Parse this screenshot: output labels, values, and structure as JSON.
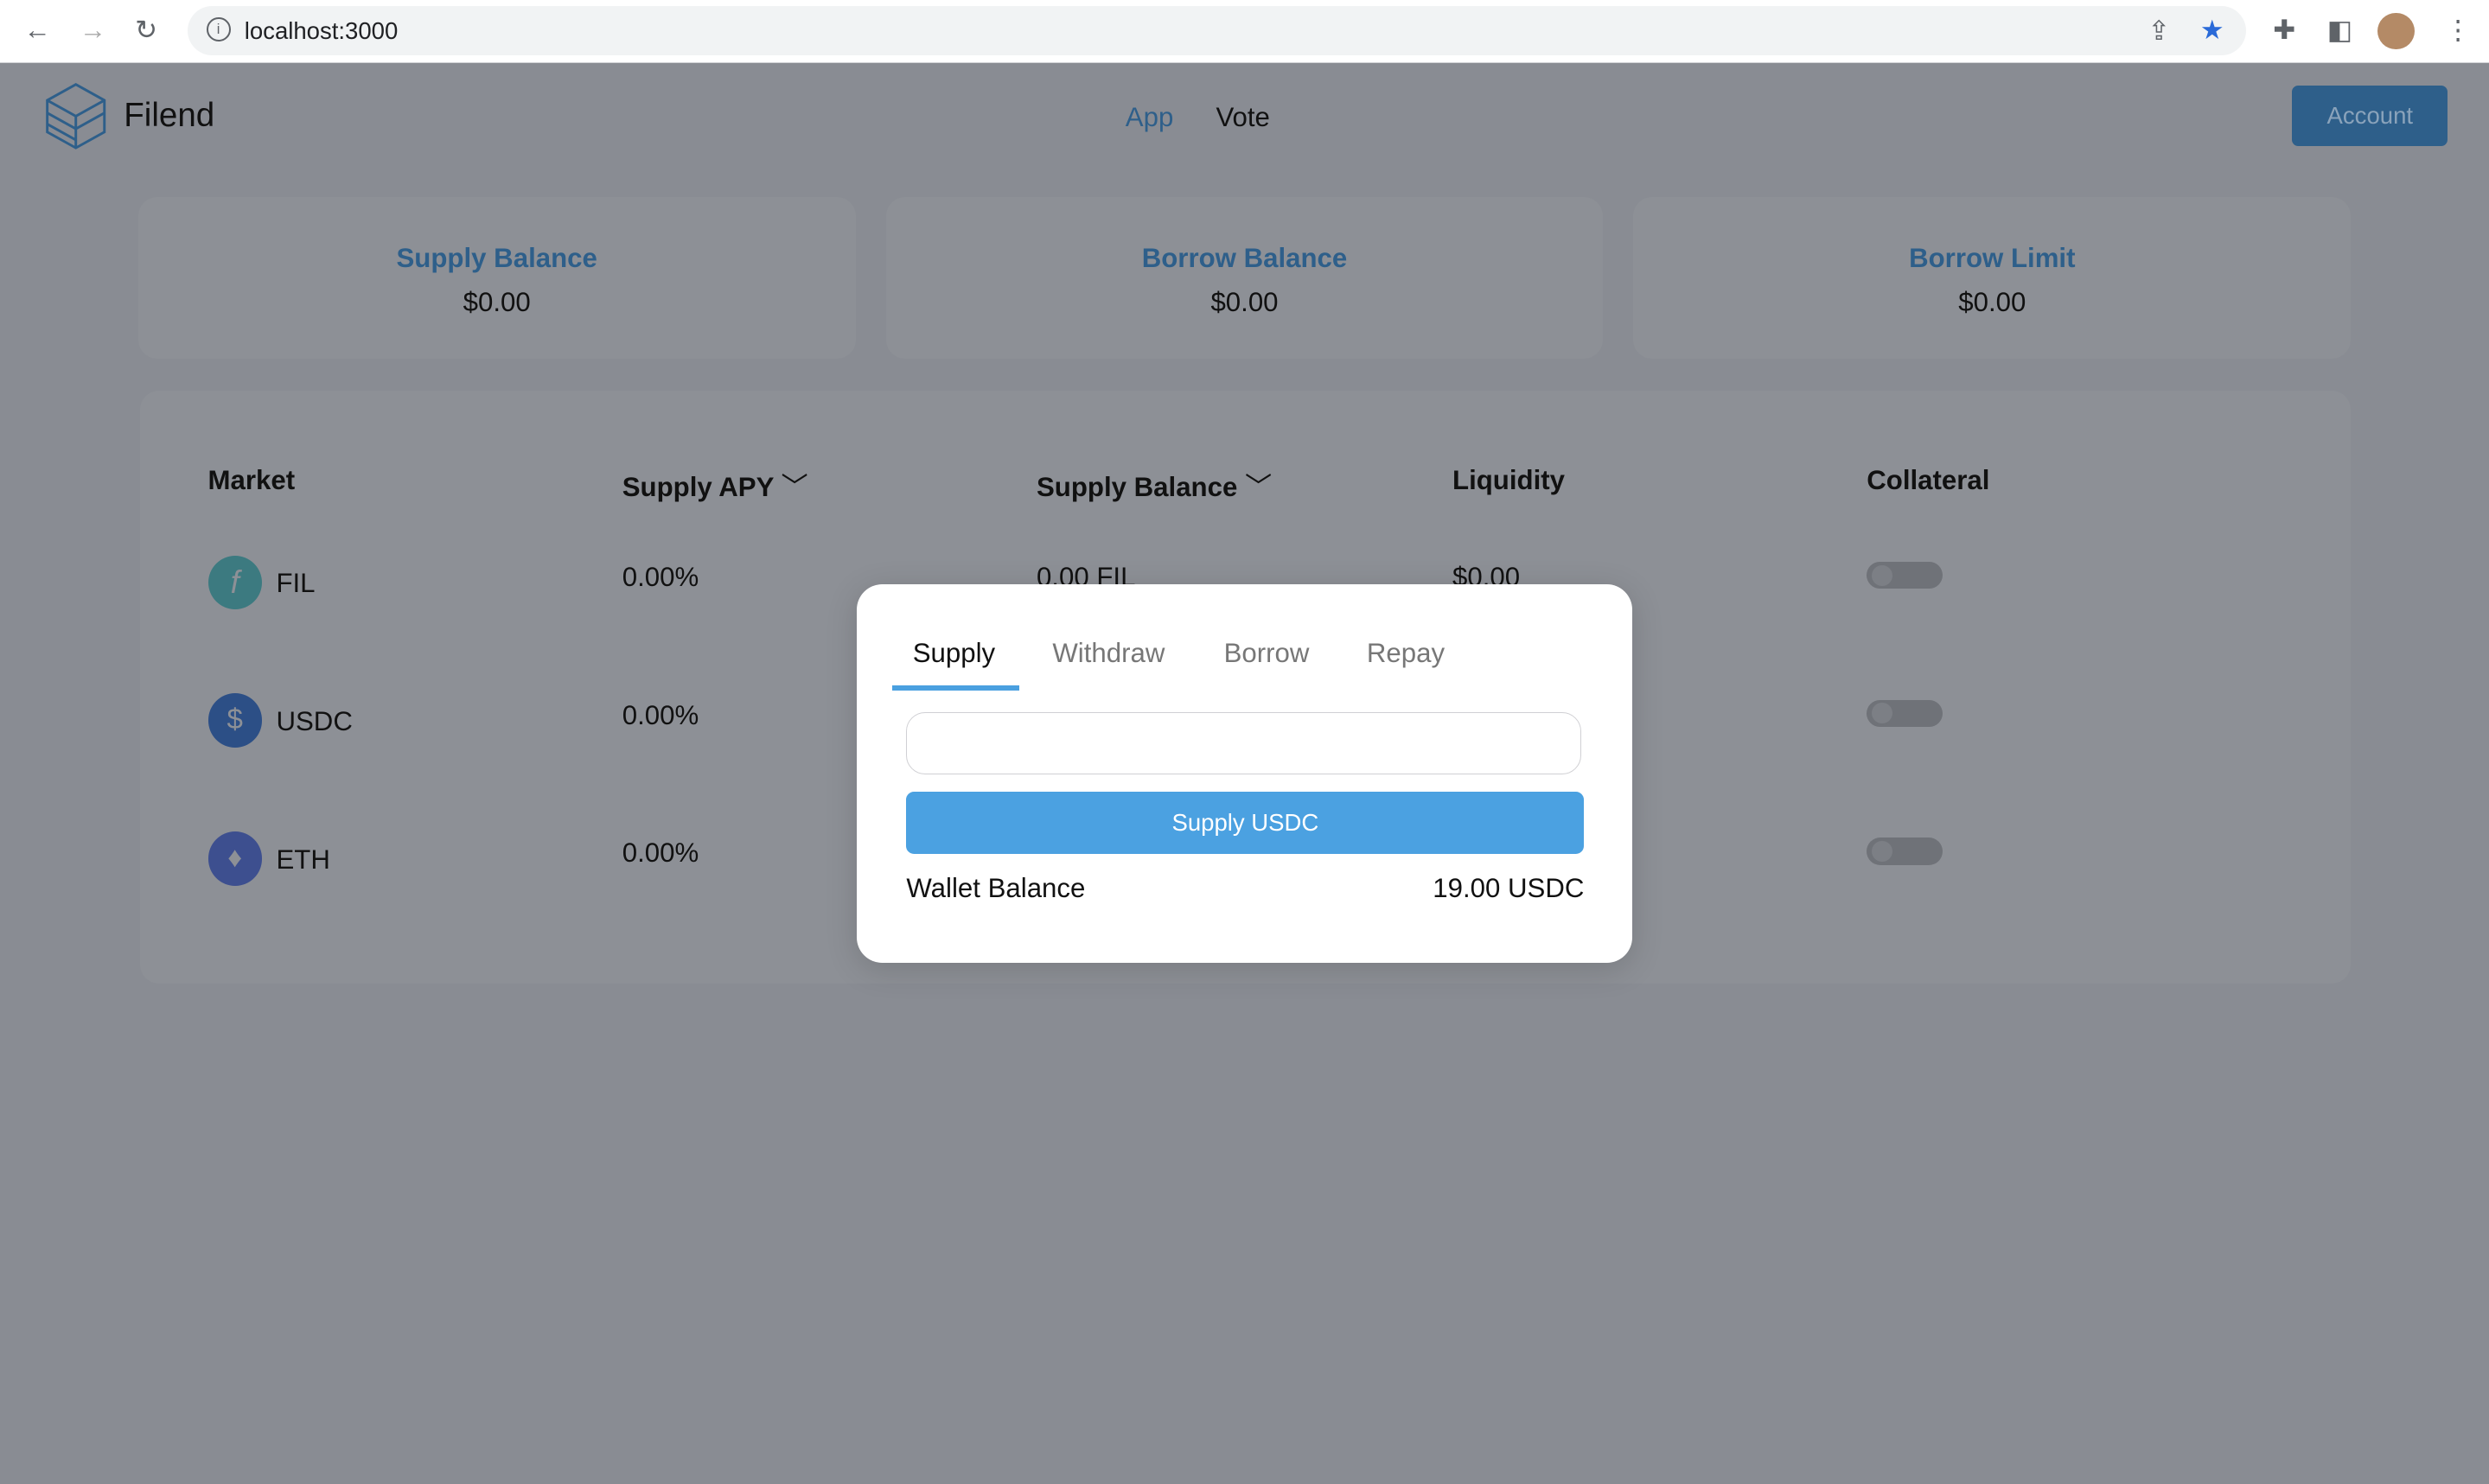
{
  "browser": {
    "url": "localhost:3000"
  },
  "header": {
    "brand": "Filend",
    "nav": [
      {
        "label": "App",
        "active": true
      },
      {
        "label": "Vote",
        "active": false
      }
    ],
    "account_label": "Account"
  },
  "summary": [
    {
      "title": "Supply Balance",
      "value": "$0.00"
    },
    {
      "title": "Borrow Balance",
      "value": "$0.00"
    },
    {
      "title": "Borrow Limit",
      "value": "$0.00"
    }
  ],
  "table": {
    "columns": [
      "Market",
      "Supply APY",
      "Supply Balance",
      "Liquidity",
      "Collateral"
    ],
    "rows": [
      {
        "market": "FIL",
        "apy": "0.00%",
        "supply_balance": "0.00 FIL",
        "liquidity": "$0.00",
        "collateral": false
      },
      {
        "market": "USDC",
        "apy": "0.00%",
        "collateral": false
      },
      {
        "market": "ETH",
        "apy": "0.00%",
        "collateral": false
      }
    ]
  },
  "modal": {
    "tabs": [
      "Supply",
      "Withdraw",
      "Borrow",
      "Repay"
    ],
    "active_tab": "Supply",
    "input_value": "",
    "button_label": "Supply USDC",
    "wallet_label": "Wallet Balance",
    "wallet_value": "19.00 USDC"
  },
  "colors": {
    "accent": "#2e5f8a",
    "button": "#4ba1e1",
    "overlay": "#898c93"
  }
}
